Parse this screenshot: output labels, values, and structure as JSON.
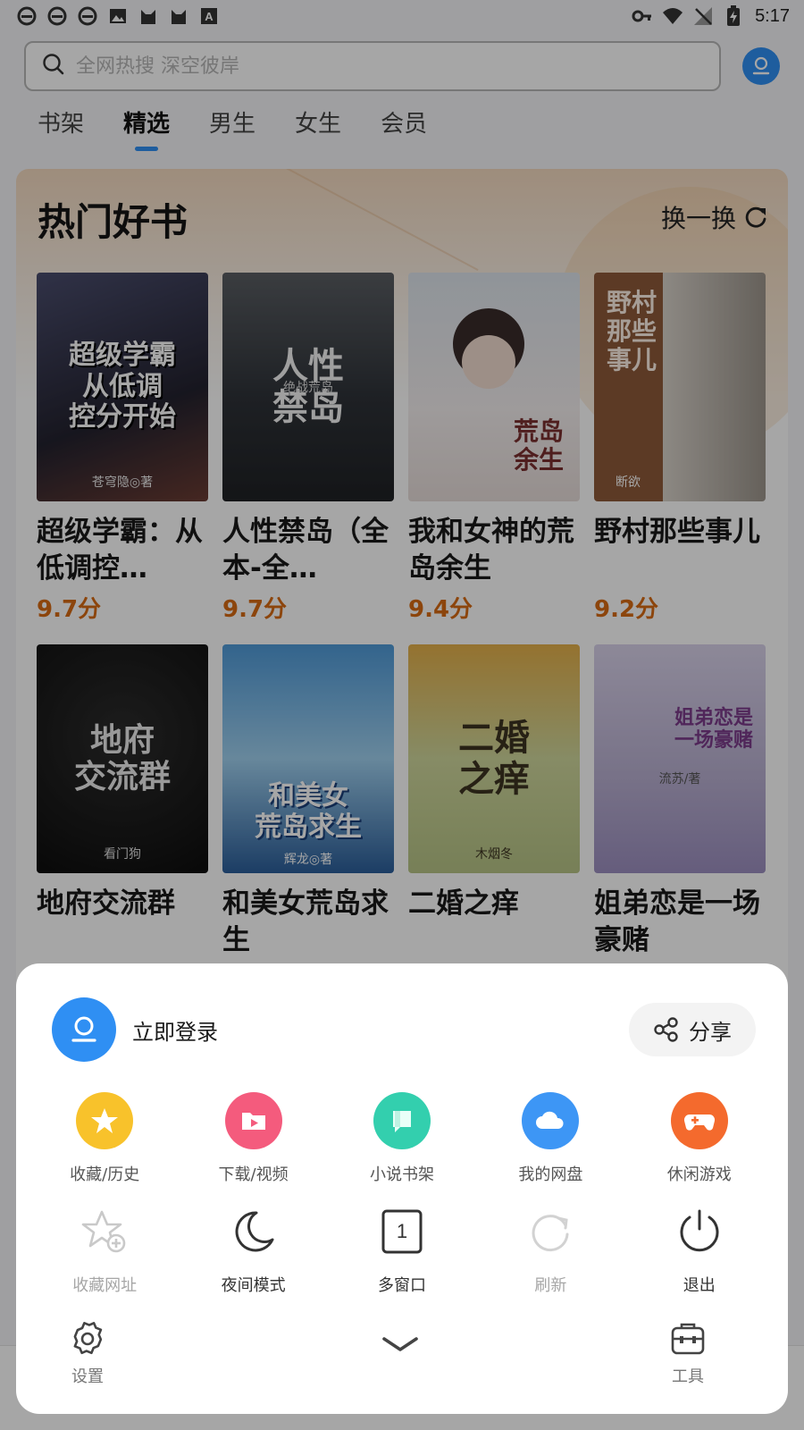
{
  "status_bar": {
    "time": "5:17",
    "left_icons": [
      "browser-e-icon",
      "browser-e-icon",
      "browser-e-icon",
      "image-icon",
      "cat-icon",
      "cat-icon",
      "font-a-icon"
    ],
    "right_icons": [
      "key-icon",
      "wifi-icon",
      "no-signal-icon",
      "battery-charging-icon"
    ]
  },
  "search": {
    "placeholder": "全网热搜 深空彼岸"
  },
  "tabs": [
    {
      "label": "书架",
      "active": false
    },
    {
      "label": "精选",
      "active": true
    },
    {
      "label": "男生",
      "active": false
    },
    {
      "label": "女生",
      "active": false
    },
    {
      "label": "会员",
      "active": false
    }
  ],
  "hot_books": {
    "title": "热门好书",
    "refresh_label": "换一换",
    "books": [
      {
        "title": "超级学霸：从低调控…",
        "score": "9.7分",
        "cover_text": "超级学霸\n从低调\n控分开始",
        "cover_author": "苍穹隐◎著",
        "cover_bg": "#2b2a3d",
        "cover_fg": "#ffffff"
      },
      {
        "title": "人性禁岛（全本-全…",
        "score": "9.7分",
        "cover_text": "人性\n禁岛",
        "cover_author": "绝战荒岛",
        "cover_bg": "#3b3f46",
        "cover_fg": "#f2f2f2"
      },
      {
        "title": "我和女神的荒岛余生",
        "score": "9.4分",
        "cover_text": "荒岛\n余生",
        "cover_author": "",
        "cover_bg": "#e8e3e6",
        "cover_fg": "#7a2e2e"
      },
      {
        "title": "野村那些事儿",
        "score": "9.2分",
        "cover_text": "野村\n那些事儿",
        "cover_author": "断欲",
        "cover_bg": "#c9c2b9",
        "cover_fg": "#6b3a1f"
      },
      {
        "title": "地府交流群",
        "score": "",
        "cover_text": "地府\n交流群",
        "cover_author": "看门狗",
        "cover_bg": "#1b1b1b",
        "cover_fg": "#e9e9e9"
      },
      {
        "title": "和美女荒岛求生",
        "score": "",
        "cover_text": "和美女\n荒岛求生",
        "cover_author": "辉龙◎著",
        "cover_bg": "#5fa4d8",
        "cover_fg": "#ffffff"
      },
      {
        "title": "二婚之痒",
        "score": "",
        "cover_text": "二婚\n之痒",
        "cover_author": "木烟冬",
        "cover_bg": "#c8d39a",
        "cover_fg": "#3c3321"
      },
      {
        "title": "姐弟恋是一场豪赌",
        "score": "",
        "cover_text": "姐弟恋是\n一场豪赌",
        "cover_author": "流苏/著",
        "cover_bg": "#b9b2cf",
        "cover_fg": "#7b3b8a"
      }
    ]
  },
  "menu": {
    "login_label": "立即登录",
    "share_label": "分享",
    "row1": [
      {
        "label": "收藏/历史",
        "icon": "star-icon",
        "color": "#f8c22b"
      },
      {
        "label": "下载/视频",
        "icon": "folder-play-icon",
        "color": "#f45b7d"
      },
      {
        "label": "小说书架",
        "icon": "book-icon",
        "color": "#33cfae"
      },
      {
        "label": "我的网盘",
        "icon": "cloud-icon",
        "color": "#3d96f5"
      },
      {
        "label": "休闲游戏",
        "icon": "gamepad-icon",
        "color": "#f46a2d"
      }
    ],
    "row2": [
      {
        "label": "收藏网址",
        "icon": "add-bookmark-icon",
        "enabled": false
      },
      {
        "label": "夜间模式",
        "icon": "moon-icon",
        "enabled": true
      },
      {
        "label": "多窗口",
        "icon": "window-count-icon",
        "enabled": true,
        "count": "1"
      },
      {
        "label": "刷新",
        "icon": "refresh-icon",
        "enabled": false
      },
      {
        "label": "退出",
        "icon": "power-icon",
        "enabled": true
      }
    ],
    "settings_label": "设置",
    "tools_label": "工具"
  }
}
